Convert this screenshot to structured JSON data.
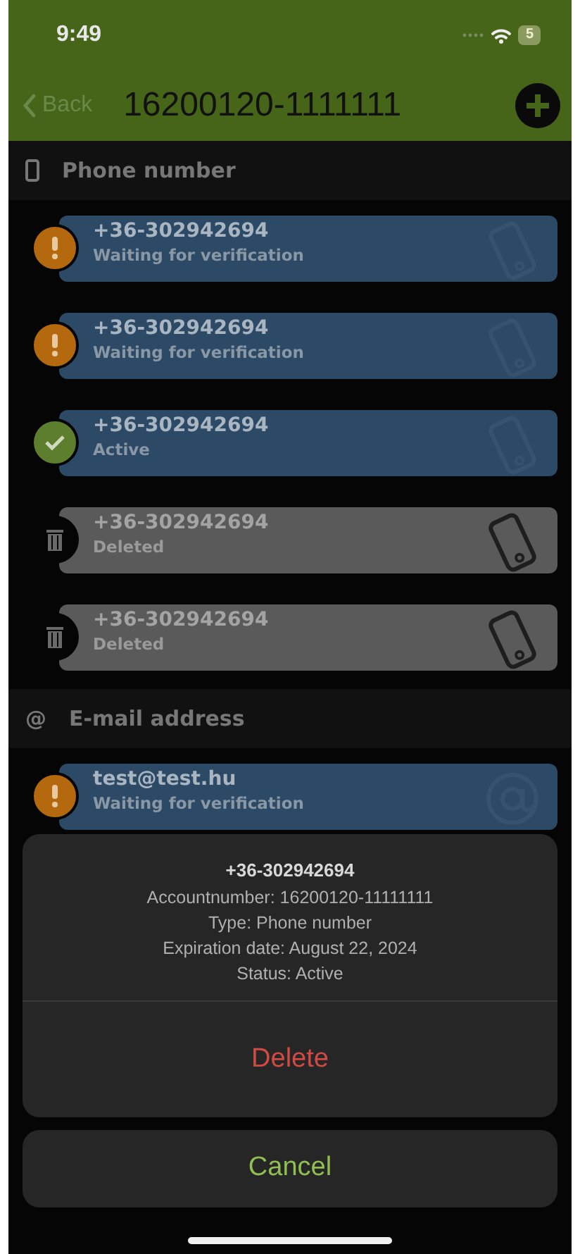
{
  "status_bar": {
    "time": "9:49",
    "battery": "5"
  },
  "nav": {
    "back": "Back",
    "title": "16200120-1111111"
  },
  "sections": [
    {
      "kind": "phone",
      "title": "Phone number",
      "items": [
        {
          "kind": "waiting",
          "value": "+36-302942694",
          "status": "Waiting for verification"
        },
        {
          "kind": "waiting",
          "value": "+36-302942694",
          "status": "Waiting for verification"
        },
        {
          "kind": "active",
          "value": "+36-302942694",
          "status": "Active"
        },
        {
          "kind": "deleted",
          "value": "+36-302942694",
          "status": "Deleted"
        },
        {
          "kind": "deleted",
          "value": "+36-302942694",
          "status": "Deleted"
        }
      ]
    },
    {
      "kind": "email",
      "icon": "@",
      "title": "E-mail address",
      "items": [
        {
          "kind": "waiting",
          "value": "test@test.hu",
          "status": "Waiting for verification"
        }
      ]
    }
  ],
  "action_sheet": {
    "title": "+36-302942694",
    "lines": [
      "Accountnumber: 16200120-11111111",
      "Type: Phone number",
      "Expiration date: August 22, 2024",
      "Status: Active"
    ],
    "destructive": "Delete",
    "cancel": "Cancel"
  }
}
